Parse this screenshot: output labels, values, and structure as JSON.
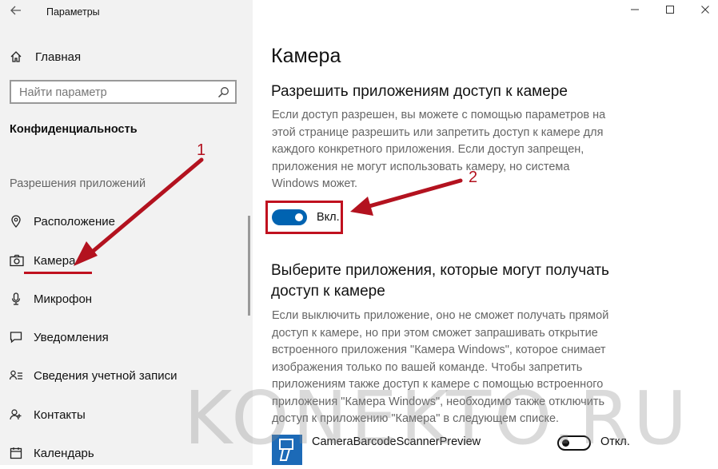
{
  "window": {
    "title": "Параметры",
    "back_icon": "back-arrow-icon",
    "minimize_icon": "minimize-icon",
    "maximize_icon": "maximize-icon",
    "close_icon": "close-icon"
  },
  "sidebar": {
    "home_label": "Главная",
    "search_placeholder": "Найти параметр",
    "section_title": "Конфиденциальность",
    "group_label": "Разрешения приложений",
    "items": [
      {
        "label": "Расположение",
        "icon": "location-pin-icon"
      },
      {
        "label": "Камера",
        "icon": "camera-icon",
        "selected": true
      },
      {
        "label": "Микрофон",
        "icon": "microphone-icon"
      },
      {
        "label": "Уведомления",
        "icon": "chat-bubble-icon"
      },
      {
        "label": "Сведения учетной записи",
        "icon": "account-info-icon"
      },
      {
        "label": "Контакты",
        "icon": "contacts-icon"
      },
      {
        "label": "Календарь",
        "icon": "calendar-icon"
      }
    ]
  },
  "main": {
    "title": "Камера",
    "allow_heading": "Разрешить приложениям доступ к камере",
    "allow_desc": [
      "Если доступ разрешен, вы можете с помощью параметров на",
      "этой странице разрешить или запретить доступ к камере для",
      "каждого конкретного приложения. Если доступ запрещен,",
      "приложения не могут использовать камеру, но система",
      "Windows может."
    ],
    "master_toggle": {
      "state": "on",
      "label": "Вкл."
    },
    "choose_heading": [
      "Выберите приложения, которые могут получать",
      "доступ к камере"
    ],
    "choose_desc": [
      "Если выключить приложение, оно не сможет получать прямой",
      "доступ к камере, но при этом сможет запрашивать открытие",
      "встроенного приложения \"Камера Windows\", которое снимает",
      "изображения только по вашей команде. Чтобы запретить",
      "приложениям также доступ к камере с помощью встроенного",
      "приложения \"Камера Windows\", необходимо также отключить",
      "доступ к приложению \"Камера\" в следующем списке."
    ],
    "apps": [
      {
        "name": "CameraBarcodeScannerPreview",
        "state": "off",
        "toggle_label": "Откл."
      }
    ]
  },
  "annotations": {
    "marker_1": "1",
    "marker_2": "2",
    "color": "#c0111f"
  },
  "watermark": "KONEKTO.RU",
  "colors": {
    "accent": "#0063b1",
    "sidebar_bg": "#f2f2f2",
    "annotation": "#c0111f"
  }
}
